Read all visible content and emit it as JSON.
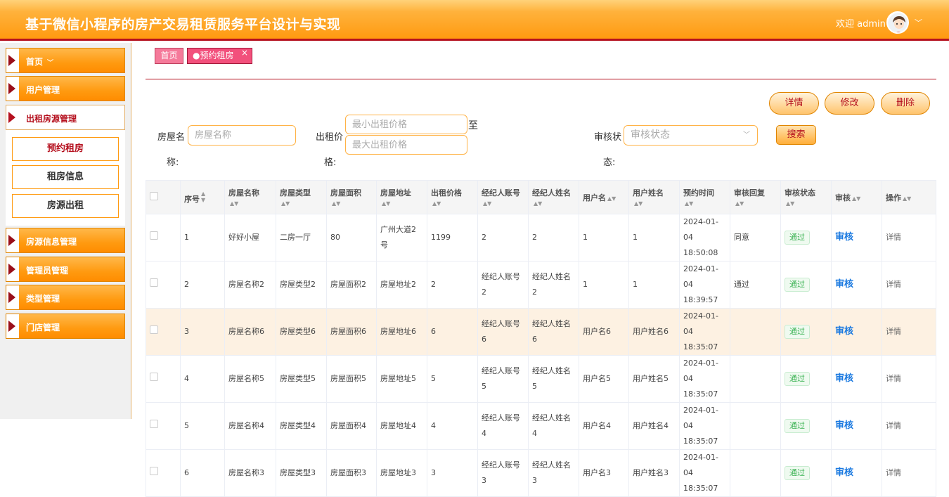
{
  "header": {
    "title": "基于微信小程序的房产交易租赁服务平台设计与实现",
    "welcome": "欢迎 admin"
  },
  "sidebar": {
    "items": [
      {
        "label": "首页"
      },
      {
        "label": "用户管理"
      },
      {
        "label": "出租房源管理"
      },
      {
        "label": "房源信息管理"
      },
      {
        "label": "管理员管理"
      },
      {
        "label": "类型管理"
      },
      {
        "label": "门店管理"
      }
    ],
    "submenu": [
      {
        "label": "预约租房"
      },
      {
        "label": "租房信息"
      },
      {
        "label": "房源出租"
      }
    ]
  },
  "breadcrumb": {
    "home": "首页",
    "current": "●预约租房",
    "close": "×"
  },
  "actions": {
    "detail": "详情",
    "edit": "修改",
    "delete": "删除",
    "search": "搜索"
  },
  "filters": {
    "house_name_label_1": "房屋名",
    "house_name_label_2": "称:",
    "house_name_placeholder": "房屋名称",
    "price_label_1": "出租价",
    "price_label_2": "格:",
    "price_min_placeholder": "最小出租价格",
    "price_max_placeholder": "最大出租价格",
    "to": "至",
    "status_label_1": "审核状",
    "status_label_2": "态:",
    "status_placeholder": "审核状态"
  },
  "table": {
    "headers": [
      "序号",
      "房屋名称",
      "房屋类型",
      "房屋面积",
      "房屋地址",
      "出租价格",
      "经纪人账号",
      "经纪人姓名",
      "用户名",
      "用户姓名",
      "预约时间",
      "审核回复",
      "审核状态",
      "审核",
      "操作"
    ],
    "rows": [
      {
        "no": "1",
        "name": "好好小屋",
        "type": "二房一厅",
        "area": "80",
        "addr": "广州大道2号",
        "price": "1199",
        "agent_acc": "2",
        "agent_name": "2",
        "user": "1",
        "user_name": "1",
        "time": "2024-01-04 18:50:08",
        "reply": "同意",
        "status": "通过",
        "audit": "审核",
        "op": "详情"
      },
      {
        "no": "2",
        "name": "房屋名称2",
        "type": "房屋类型2",
        "area": "房屋面积2",
        "addr": "房屋地址2",
        "price": "2",
        "agent_acc": "经纪人账号2",
        "agent_name": "经纪人姓名2",
        "user": "1",
        "user_name": "1",
        "time": "2024-01-04 18:39:57",
        "reply": "通过",
        "status": "通过",
        "audit": "审核",
        "op": "详情"
      },
      {
        "no": "3",
        "name": "房屋名称6",
        "type": "房屋类型6",
        "area": "房屋面积6",
        "addr": "房屋地址6",
        "price": "6",
        "agent_acc": "经纪人账号6",
        "agent_name": "经纪人姓名6",
        "user": "用户名6",
        "user_name": "用户姓名6",
        "time": "2024-01-04 18:35:07",
        "reply": "",
        "status": "通过",
        "audit": "审核",
        "op": "详情"
      },
      {
        "no": "4",
        "name": "房屋名称5",
        "type": "房屋类型5",
        "area": "房屋面积5",
        "addr": "房屋地址5",
        "price": "5",
        "agent_acc": "经纪人账号5",
        "agent_name": "经纪人姓名5",
        "user": "用户名5",
        "user_name": "用户姓名5",
        "time": "2024-01-04 18:35:07",
        "reply": "",
        "status": "通过",
        "audit": "审核",
        "op": "详情"
      },
      {
        "no": "5",
        "name": "房屋名称4",
        "type": "房屋类型4",
        "area": "房屋面积4",
        "addr": "房屋地址4",
        "price": "4",
        "agent_acc": "经纪人账号4",
        "agent_name": "经纪人姓名4",
        "user": "用户名4",
        "user_name": "用户姓名4",
        "time": "2024-01-04 18:35:07",
        "reply": "",
        "status": "通过",
        "audit": "审核",
        "op": "详情"
      },
      {
        "no": "6",
        "name": "房屋名称3",
        "type": "房屋类型3",
        "area": "房屋面积3",
        "addr": "房屋地址3",
        "price": "3",
        "agent_acc": "经纪人账号3",
        "agent_name": "经纪人姓名3",
        "user": "用户名3",
        "user_name": "用户姓名3",
        "time": "2024-01-04 18:35:07",
        "reply": "",
        "status": "通过",
        "audit": "审核",
        "op": "详情"
      }
    ]
  }
}
